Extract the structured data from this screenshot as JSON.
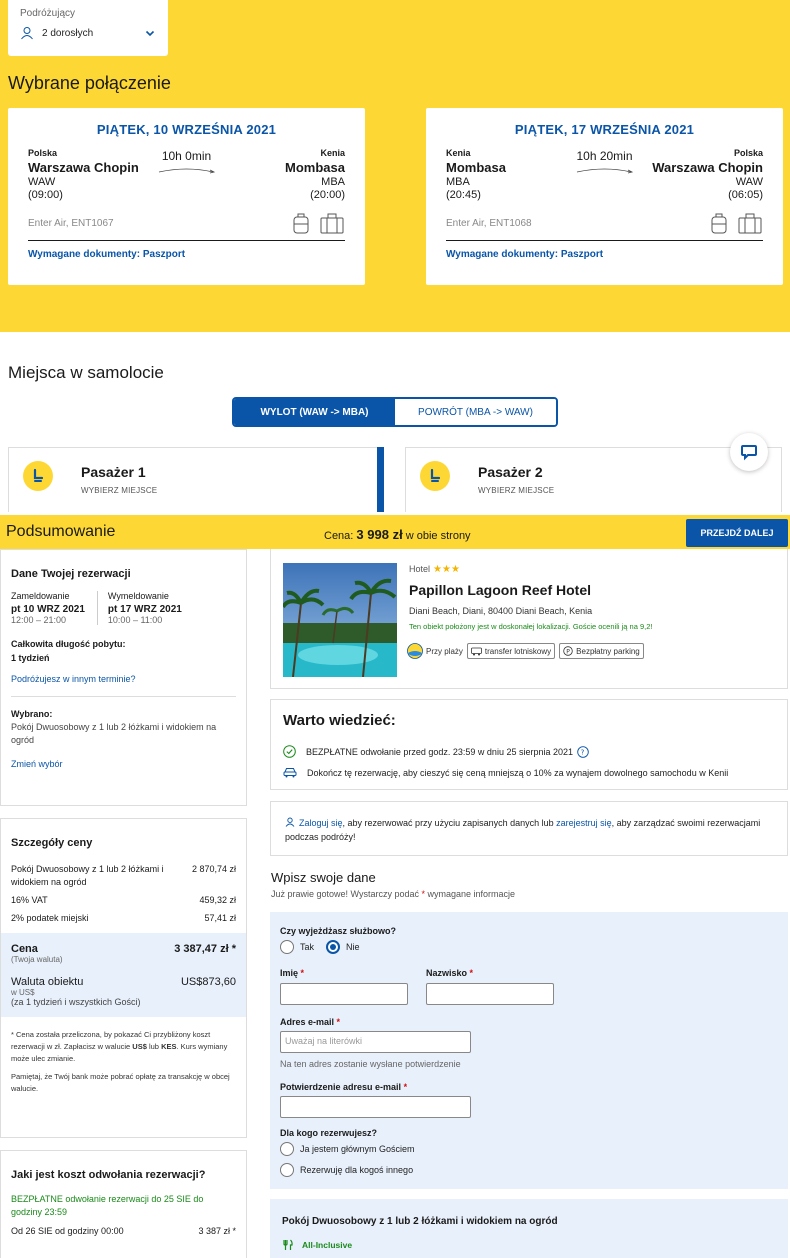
{
  "travelers": {
    "label": "Podróżujący",
    "value": "2 dorosłych"
  },
  "selected_title": "Wybrane połączenie",
  "flights": [
    {
      "date": "PIĄTEK, 10 WRZEŚNIA 2021",
      "from_country": "Polska",
      "from_city": "Warszawa Chopin",
      "from_code": "WAW",
      "from_time": "(09:00)",
      "duration": "10h 0min",
      "to_country": "Kenia",
      "to_city": "Mombasa",
      "to_code": "MBA",
      "to_time": "(20:00)",
      "airline": "Enter Air, ENT1067",
      "docs": "Wymagane dokumenty: Paszport"
    },
    {
      "date": "PIĄTEK, 17 WRZEŚNIA 2021",
      "from_country": "Kenia",
      "from_city": "Mombasa",
      "from_code": "MBA",
      "from_time": "(20:45)",
      "duration": "10h 20min",
      "to_country": "Polska",
      "to_city": "Warszawa Chopin",
      "to_code": "WAW",
      "to_time": "(06:05)",
      "airline": "Enter Air, ENT1068",
      "docs": "Wymagane dokumenty: Paszport"
    }
  ],
  "seats": {
    "title": "Miejsca w samolocie",
    "tab_out": "WYLOT (WAW -> MBA)",
    "tab_back": "POWRÓT (MBA -> WAW)",
    "passengers": [
      {
        "name": "Pasażer 1",
        "action": "WYBIERZ MIEJSCE"
      },
      {
        "name": "Pasażer 2",
        "action": "WYBIERZ MIEJSCE"
      }
    ]
  },
  "summary": {
    "title": "Podsumowanie",
    "price_label": "Cena:",
    "price_value": "3 998 zł",
    "price_suffix": "w obie strony",
    "next_button": "PRZEJDŹ DALEJ"
  },
  "booking": {
    "title": "Dane Twojej rezerwacji",
    "checkin_label": "Zameldowanie",
    "checkin_date": "pt 10 WRZ 2021",
    "checkin_time": "12:00 – 21:00",
    "checkout_label": "Wymeldowanie",
    "checkout_date": "pt 17 WRZ 2021",
    "checkout_time": "10:00 – 11:00",
    "stay_label": "Całkowita długość pobytu:",
    "stay_value": "1 tydzień",
    "other_dates_link": "Podróżujesz w innym terminie?",
    "chosen_label": "Wybrano:",
    "chosen_value": "Pokój Dwuosobowy z 1 lub 2 łóżkami i widokiem na ogród",
    "change_link": "Zmień wybór"
  },
  "price_details": {
    "title": "Szczegóły ceny",
    "lines": [
      {
        "label": "Pokój Dwuosobowy z 1 lub 2 łóżkami i widokiem na ogród",
        "value": "2 870,74 zł"
      },
      {
        "label": "16% VAT",
        "value": "459,32 zł"
      },
      {
        "label": "2% podatek miejski",
        "value": "57,41 zł"
      }
    ],
    "total_label": "Cena",
    "total_sub": "(Twoja waluta)",
    "total_value": "3 387,47 zł *",
    "prop_currency_label": "Waluta obiektu",
    "prop_currency_sub1": "w US$",
    "prop_currency_sub2": "(za 1 tydzień i wszystkich Gości)",
    "prop_currency_value": "US$873,60",
    "note1_a": "* Cena została przeliczona, by pokazać Ci przybliżony koszt rezerwacji w zł. Zapłacisz w walucie ",
    "note1_b": "US$",
    "note1_c": " lub ",
    "note1_d": "KES",
    "note1_e": ". Kurs wymiany może ulec zmianie.",
    "note2": "Pamiętaj, że Twój bank może pobrać opłatę za transakcję w obcej walucie."
  },
  "cancellation": {
    "title": "Jaki jest koszt odwołania rezerwacji?",
    "free_text": "BEZPŁATNE odwołanie rezerwacji do 25 SIE do godziny 23:59",
    "from_label": "Od 26 SIE od godziny 00:00",
    "from_value": "3 387 zł *"
  },
  "hotel": {
    "type": "Hotel",
    "stars": "★★★",
    "name": "Papillon Lagoon Reef Hotel",
    "address": "Diani Beach, Diani, 80400 Diani Beach, Kenia",
    "location_note": "Ten obiekt położony jest w doskonałej lokalizacji. Goście ocenili ją na 9,2!",
    "tags": [
      "Przy plaży",
      "transfer lotniskowy",
      "Bezpłatny parking"
    ]
  },
  "worth_knowing": {
    "title": "Warto wiedzieć:",
    "free_cancel": "BEZPŁATNE odwołanie przed godz. 23:59 w dniu 25 sierpnia 2021",
    "car_note": "Dokończ tę rezerwację, aby cieszyć się ceną mniejszą o 10% za wynajem dowolnego samochodu w Kenii"
  },
  "login": {
    "link1": "Zaloguj się",
    "text1": ", aby rezerwować przy użyciu zapisanych danych lub ",
    "link2": "zarejestruj się",
    "text2": ", aby zarządzać swoimi rezerwacjami podczas podróży!"
  },
  "form": {
    "title": "Wpisz swoje dane",
    "subtitle_a": "Już prawie gotowe! Wystarczy podać ",
    "subtitle_star": "*",
    "subtitle_b": " wymagane informacje",
    "business_label": "Czy wyjeżdżasz służbowo?",
    "yes": "Tak",
    "no": "Nie",
    "first_name": "Imię",
    "last_name": "Nazwisko",
    "email_label": "Adres e-mail",
    "email_placeholder": "Uważaj na literówki",
    "email_hint": "Na ten adres zostanie wysłane potwierdzenie",
    "email_confirm_label": "Potwierdzenie adresu e-mail",
    "for_whom_label": "Dla kogo rezerwujesz?",
    "opt_main": "Ja jestem głównym Gościem",
    "opt_other": "Rezerwuję dla kogoś innego",
    "star": "*"
  },
  "room": {
    "title": "Pokój Dwuosobowy z 1 lub 2 łóżkami i widokiem na ogród",
    "meal": "All-Inclusive"
  },
  "colors": {
    "brand_yellow": "#fdd835",
    "brand_blue": "#0a55a8",
    "green": "#1a8a1a"
  }
}
